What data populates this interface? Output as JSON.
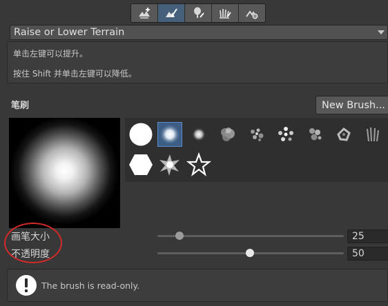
{
  "toolbar": {
    "tools": [
      {
        "icon": "create-terrain-icon"
      },
      {
        "icon": "paint-terrain-icon",
        "active": true
      },
      {
        "icon": "paint-trees-icon"
      },
      {
        "icon": "paint-details-icon"
      },
      {
        "icon": "terrain-settings-icon"
      }
    ]
  },
  "tool_select": {
    "selected": "Raise or Lower Terrain"
  },
  "help": {
    "line1": "单击左键可以提升。",
    "line2": "按住 Shift 并单击左键可以降低。"
  },
  "brushes": {
    "section_label": "笔刷",
    "new_button": "New Brush...",
    "selected_index": 1
  },
  "settings": {
    "size_label": "画笔大小",
    "size_value": "25",
    "opacity_label": "不透明度",
    "opacity_value": "50",
    "size_fraction": 0.1,
    "opacity_fraction": 0.5
  },
  "info": {
    "icon": "exclamation-icon",
    "text": "The brush is read-only."
  },
  "colors": {
    "active_tool": "#46607c",
    "highlight": "#d42a2a"
  }
}
